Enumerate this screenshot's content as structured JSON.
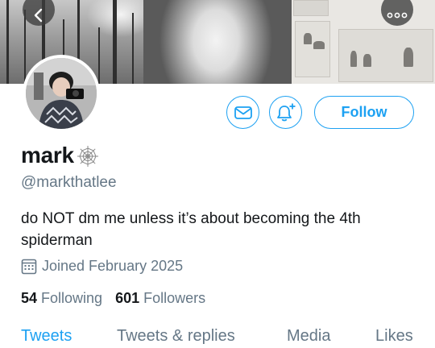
{
  "header": {
    "back_icon": "chevron-left-icon",
    "more_icon": "more-horizontal-icon"
  },
  "profile": {
    "display_name": "mark",
    "name_emoji": "spider-web-icon",
    "handle": "@markthatlee",
    "bio": "do NOT dm me unless it’s about becoming the 4th spiderman",
    "joined": "Joined February 2025",
    "following_count": "54",
    "following_label": "Following",
    "followers_count": "601",
    "followers_label": "Followers"
  },
  "actions": {
    "message_icon": "envelope-icon",
    "notify_icon": "bell-plus-icon",
    "follow_label": "Follow"
  },
  "tabs": [
    {
      "label": "Tweets",
      "active": true
    },
    {
      "label": "Tweets & replies",
      "active": false
    },
    {
      "label": "Media",
      "active": false
    },
    {
      "label": "Likes",
      "active": false
    }
  ],
  "colors": {
    "accent": "#1da1f2",
    "text_primary": "#14171a",
    "text_secondary": "#657786"
  }
}
